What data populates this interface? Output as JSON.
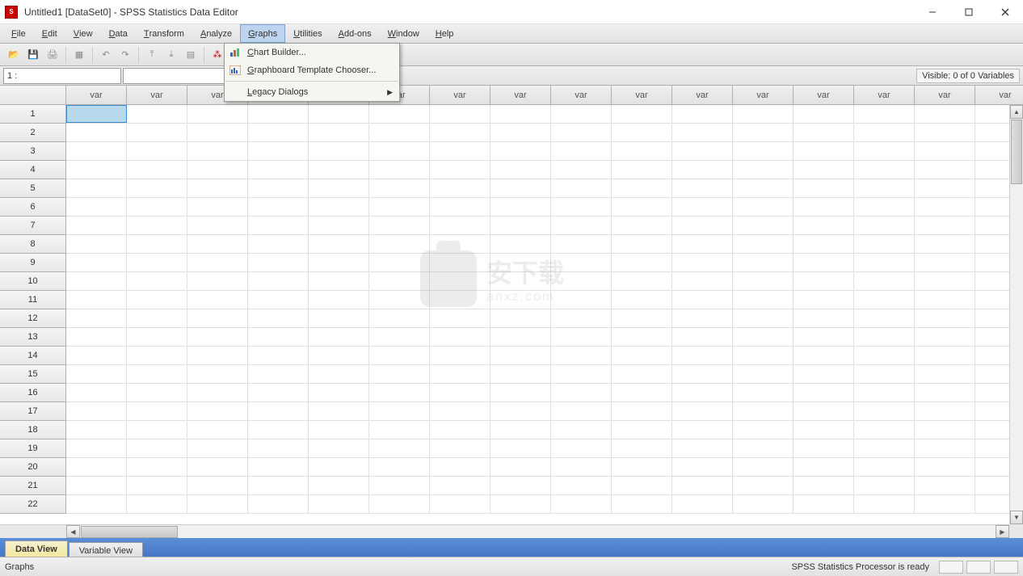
{
  "title": "Untitled1 [DataSet0] - SPSS Statistics Data Editor",
  "menubar": [
    "File",
    "Edit",
    "View",
    "Data",
    "Transform",
    "Analyze",
    "Graphs",
    "Utilities",
    "Add-ons",
    "Window",
    "Help"
  ],
  "activeMenu": "Graphs",
  "dropdown": {
    "items": [
      {
        "label": "Chart Builder...",
        "icon": "chart",
        "u": "C"
      },
      {
        "label": "Graphboard Template Chooser...",
        "icon": "graphboard",
        "u": "G"
      }
    ],
    "submenu": {
      "label": "Legacy Dialogs",
      "u": "L"
    }
  },
  "addr": {
    "cell": "1 :"
  },
  "visibleVars": "Visible: 0 of 0 Variables",
  "colHeader": "var",
  "rowCount": 22,
  "colCount": 16,
  "viewTabs": {
    "active": "Data View",
    "inactive": "Variable View"
  },
  "status": {
    "left": "Graphs",
    "proc": "SPSS Statistics Processor is ready"
  },
  "watermark": {
    "main": "安下载",
    "sub": "anxz.com"
  }
}
